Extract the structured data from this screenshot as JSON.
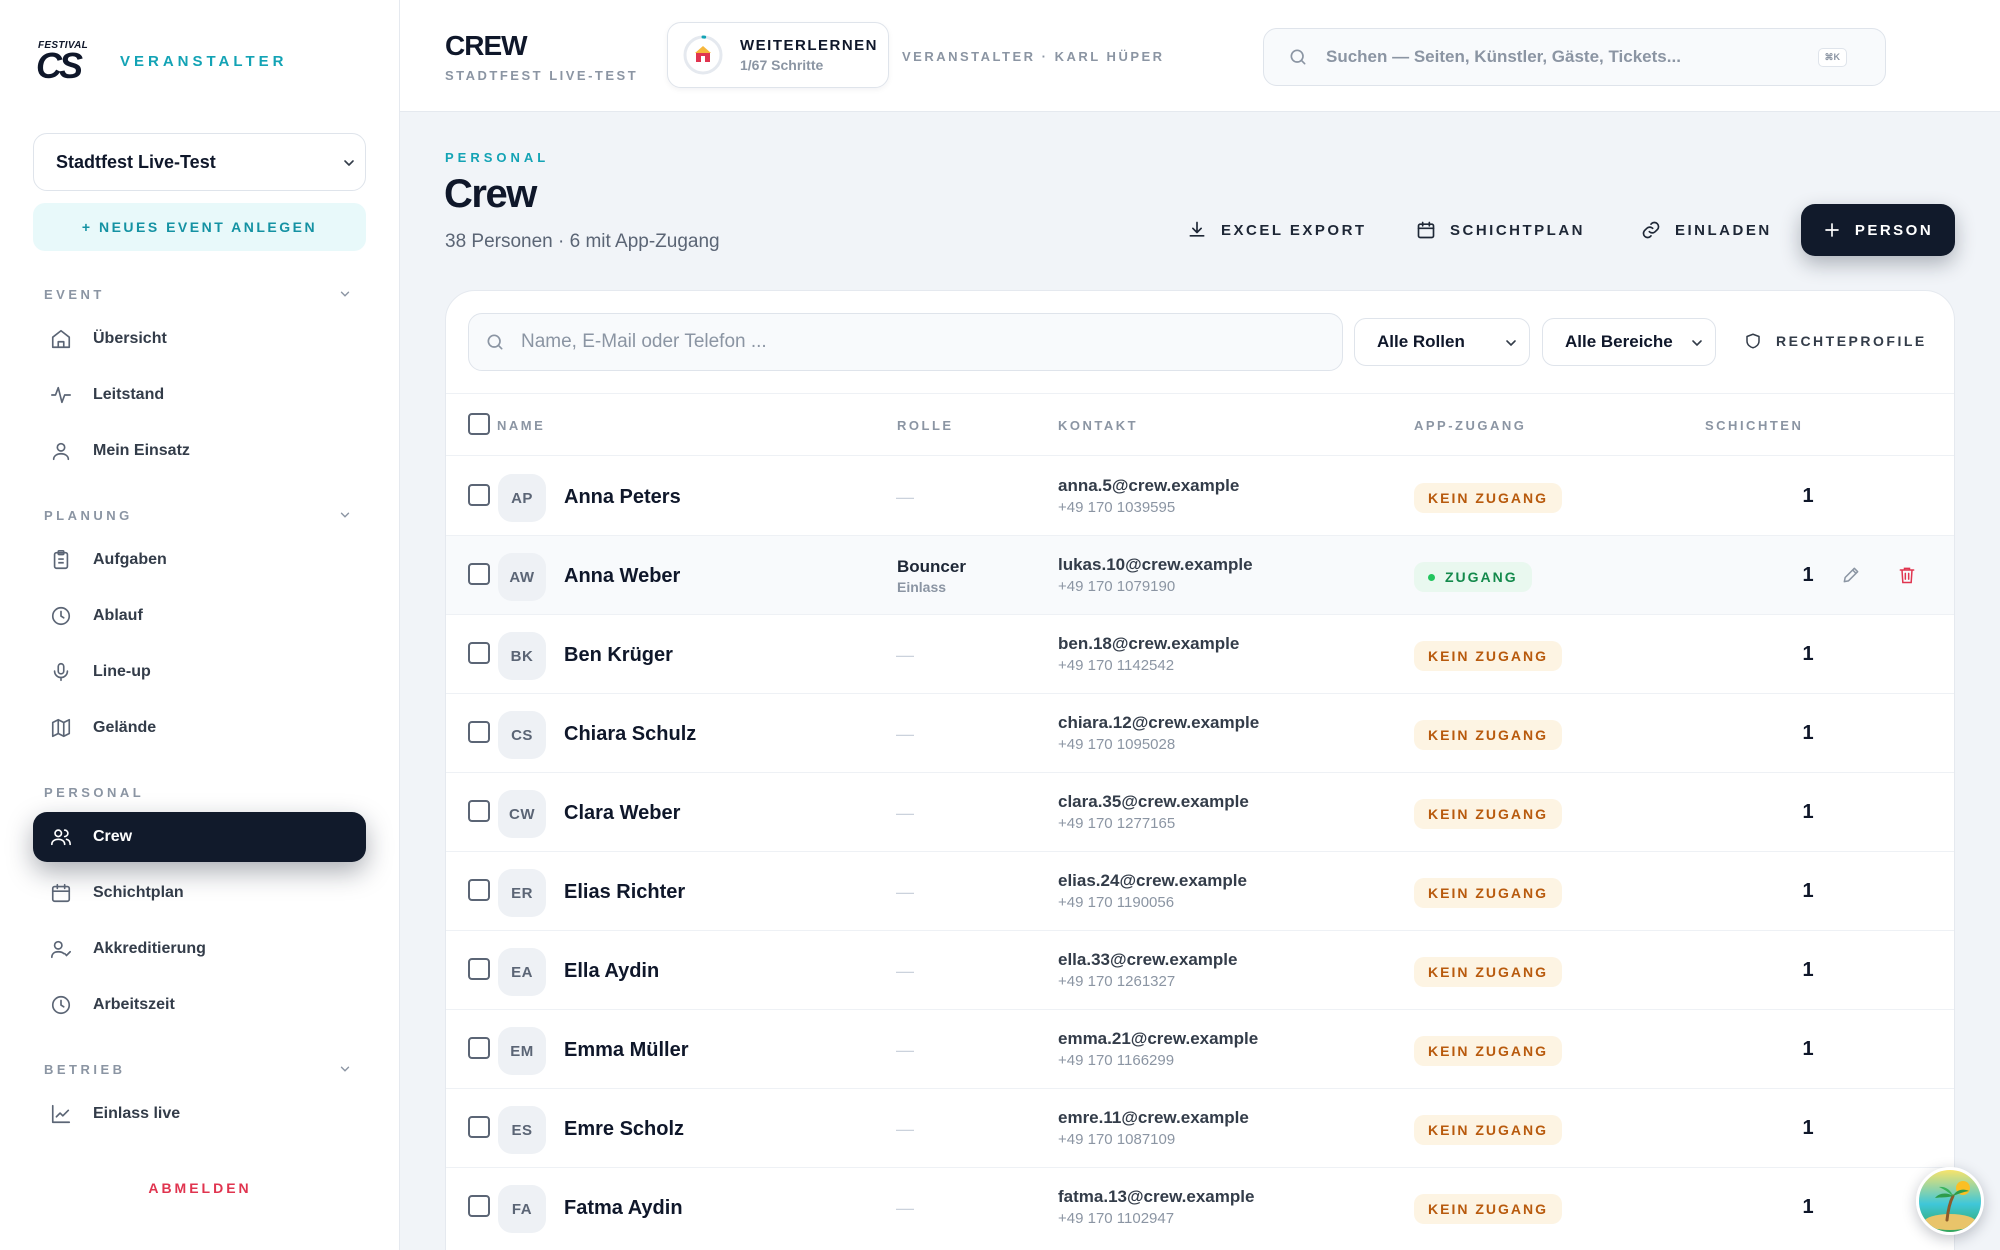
{
  "brand": {
    "logo_small": "FESTIVAL",
    "logo_big": "CS",
    "role_label": "VERANSTALTER"
  },
  "sidebar": {
    "event_select": "Stadtfest Live-Test",
    "new_event": "+ NEUES EVENT ANLEGEN",
    "sections": [
      {
        "title": "EVENT",
        "items": [
          "Übersicht",
          "Leitstand",
          "Mein Einsatz"
        ]
      },
      {
        "title": "PLANUNG",
        "items": [
          "Aufgaben",
          "Ablauf",
          "Line-up",
          "Gelände"
        ]
      },
      {
        "title": "PERSONAL",
        "items": [
          "Crew",
          "Schichtplan",
          "Akkreditierung",
          "Arbeitszeit"
        ]
      },
      {
        "title": "BETRIEB",
        "items": [
          "Einlass live"
        ]
      }
    ],
    "active_item": "Crew",
    "logout": "ABMELDEN"
  },
  "topbar": {
    "title": "CREW",
    "subtitle": "STADTFEST LIVE-TEST",
    "learn_title": "WEITERLERNEN",
    "learn_progress": "1/67 Schritte",
    "learn_progress_fraction": 0.015,
    "organizer": "VERANSTALTER · KARL HÜPER",
    "search_placeholder": "Suchen — Seiten, Künstler, Gäste, Tickets...",
    "search_shortcut": "⌘K"
  },
  "header": {
    "kicker": "PERSONAL",
    "title": "Crew",
    "summary": "38 Personen · 6 mit App-Zugang",
    "actions": {
      "export": "EXCEL EXPORT",
      "schedule": "SCHICHTPLAN",
      "invite": "EINLADEN",
      "add": "PERSON"
    }
  },
  "filters": {
    "search_placeholder": "Name, E-Mail oder Telefon ...",
    "roles": "Alle Rollen",
    "areas": "Alle Bereiche",
    "rights": "RECHTEPROFILE"
  },
  "table": {
    "columns": {
      "name": "NAME",
      "role": "ROLLE",
      "contact": "KONTAKT",
      "access": "APP-ZUGANG",
      "shifts": "SCHICHTEN"
    },
    "rows": [
      {
        "initials": "AP",
        "name": "Anna Peters",
        "role": "—",
        "role_sub": "",
        "email": "anna.5@crew.example",
        "phone": "+49 170 1039595",
        "access": "KEIN ZUGANG",
        "has_access": false,
        "shifts": "1"
      },
      {
        "initials": "AW",
        "name": "Anna Weber",
        "role": "Bouncer",
        "role_sub": "Einlass",
        "email": "lukas.10@crew.example",
        "phone": "+49 170 1079190",
        "access": "ZUGANG",
        "has_access": true,
        "shifts": "1"
      },
      {
        "initials": "BK",
        "name": "Ben Krüger",
        "role": "—",
        "role_sub": "",
        "email": "ben.18@crew.example",
        "phone": "+49 170 1142542",
        "access": "KEIN ZUGANG",
        "has_access": false,
        "shifts": "1"
      },
      {
        "initials": "CS",
        "name": "Chiara Schulz",
        "role": "—",
        "role_sub": "",
        "email": "chiara.12@crew.example",
        "phone": "+49 170 1095028",
        "access": "KEIN ZUGANG",
        "has_access": false,
        "shifts": "1"
      },
      {
        "initials": "CW",
        "name": "Clara Weber",
        "role": "—",
        "role_sub": "",
        "email": "clara.35@crew.example",
        "phone": "+49 170 1277165",
        "access": "KEIN ZUGANG",
        "has_access": false,
        "shifts": "1"
      },
      {
        "initials": "ER",
        "name": "Elias Richter",
        "role": "—",
        "role_sub": "",
        "email": "elias.24@crew.example",
        "phone": "+49 170 1190056",
        "access": "KEIN ZUGANG",
        "has_access": false,
        "shifts": "1"
      },
      {
        "initials": "EA",
        "name": "Ella Aydin",
        "role": "—",
        "role_sub": "",
        "email": "ella.33@crew.example",
        "phone": "+49 170 1261327",
        "access": "KEIN ZUGANG",
        "has_access": false,
        "shifts": "1"
      },
      {
        "initials": "EM",
        "name": "Emma Müller",
        "role": "—",
        "role_sub": "",
        "email": "emma.21@crew.example",
        "phone": "+49 170 1166299",
        "access": "KEIN ZUGANG",
        "has_access": false,
        "shifts": "1"
      },
      {
        "initials": "ES",
        "name": "Emre Scholz",
        "role": "—",
        "role_sub": "",
        "email": "emre.11@crew.example",
        "phone": "+49 170 1087109",
        "access": "KEIN ZUGANG",
        "has_access": false,
        "shifts": "1"
      },
      {
        "initials": "FA",
        "name": "Fatma Aydin",
        "role": "—",
        "role_sub": "",
        "email": "fatma.13@crew.example",
        "phone": "+49 170 1102947",
        "access": "KEIN ZUGANG",
        "has_access": false,
        "shifts": "1"
      }
    ]
  },
  "colors": {
    "accent": "#13a3b5",
    "dark": "#111a2b",
    "danger": "#e0344f",
    "warn": "#b85a0d",
    "success": "#148a4c"
  }
}
